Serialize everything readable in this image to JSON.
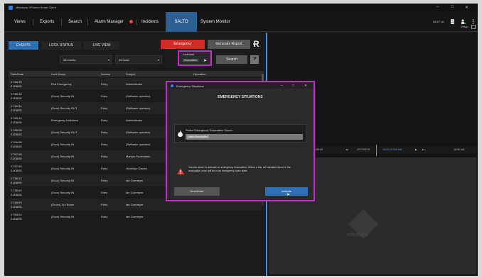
{
  "window": {
    "title": "Milestone XProtect Smart Client",
    "controls": [
      "–",
      "□",
      "✕"
    ]
  },
  "menubar": {
    "items": [
      "Views",
      "Exports",
      "Search",
      "Alarm Manager",
      "Incidents",
      "SALTO",
      "System Monitor"
    ],
    "active": "SALTO",
    "clock": "06:27:16",
    "setup": "Setup"
  },
  "events_panel": {
    "tabs": [
      "EVENTS",
      "LOCK STATUS",
      "LIVE VIEW"
    ],
    "emergency_button": "Emergency",
    "report_button": "Generate Report",
    "filter_events": "All events",
    "filter_locks": "All locks",
    "search_button": "Search",
    "lock_menu": {
      "options": [
        "Lockdown",
        "Evacuation"
      ],
      "selected": "Evacuation"
    },
    "columns": [
      "Date/Date",
      "Lock Name",
      "Access",
      "Subject",
      "Operation"
    ],
    "rows": [
      {
        "time": "17:59:36",
        "date": "21/08/05",
        "lock": "End Emergency",
        "access": "Entry",
        "subject": "Administrator",
        "operation": "Software Operator Emergency End"
      },
      {
        "time": "17:59:35",
        "date": "21/08/05",
        "lock": "(Door) Security IN",
        "access": "Entry",
        "subject": "(Software operator)",
        "operation": "End of forced closing (online from host)"
      },
      {
        "time": "17:59:34",
        "date": "21/08/05",
        "lock": "(Door) Security OUT",
        "access": "Entry",
        "subject": "(Software operator)",
        "operation": "End of forced closing (online from host)"
      },
      {
        "time": "17:59:10",
        "date": "21/08/05",
        "lock": "Emergency lockdown",
        "access": "Entry",
        "subject": "Administrator",
        "operation": ""
      },
      {
        "time": "17:59:08",
        "date": "21/08/05",
        "lock": "(Door) Security OUT",
        "access": "Entry",
        "subject": "(Software operator)",
        "operation": ""
      },
      {
        "time": "17:59:08",
        "date": "21/08/05",
        "lock": "(Door) Security IN",
        "access": "Entry",
        "subject": "(Software operator)",
        "operation": ""
      },
      {
        "time": "17:57:06",
        "date": "21/08/05",
        "lock": "(Door) Security IN",
        "access": "Entry",
        "subject": "Markus Rodenstein",
        "operation": ""
      },
      {
        "time": "17:57:00",
        "date": "21/08/05",
        "lock": "(Door) Security IN",
        "access": "Entry",
        "subject": "Llewellyn Davies",
        "operation": ""
      },
      {
        "time": "17:56:42",
        "date": "21/08/05",
        "lock": "(Door) Security IN",
        "access": "Entry",
        "subject": "Ian Gormeyer",
        "operation": ""
      },
      {
        "time": "17:56:00",
        "date": "21/08/05",
        "lock": "(Door) Security IN",
        "access": "Entry",
        "subject": "Ian Gormeyer",
        "operation": ""
      },
      {
        "time": "17:55:59",
        "date": "21/08/05",
        "lock": "(Room) 1'lo Room",
        "access": "Entry",
        "subject": "Ian Gormeyer",
        "operation": ""
      },
      {
        "time": "17:54:04",
        "date": "21/08/05",
        "lock": "(Door) Security IN",
        "access": "Entry",
        "subject": "Ian Gormeyer",
        "operation": ""
      }
    ]
  },
  "modal": {
    "title": "Emergency Situations",
    "heading": "EMERGENCY SITUATIONS",
    "zones_label": "Select Emergency Evacuation Zones:",
    "zone_value": "Main Evacuation",
    "message": "You are about to activate an emergency evacuation. Within a few, all indicated doors in the evacuation zone will be in an emergency open state.",
    "deactivate_button": "Deactivate",
    "activate_button": "Activate",
    "controls": [
      "–",
      "□",
      "✕"
    ]
  },
  "timeline": {
    "left_time": "09:59:00",
    "date": "2021/08/16",
    "current": "10:26:13.000 AM",
    "right_time": "10:00 AM"
  },
  "watermark": "milestone",
  "colors": {
    "accent": "#2d6fb2",
    "emergency": "#d22a25",
    "highlight": "#c22ec9"
  }
}
